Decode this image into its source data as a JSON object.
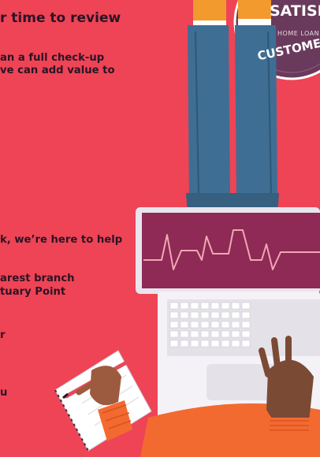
{
  "content": {
    "heading": "r time to review",
    "para1_line1": "an a full check-up",
    "para1_line2": "ve can add value to",
    "help_line": "k, we’re here to help",
    "branch_line1": "arest branch",
    "branch_line2": "tuary Point",
    "fragment_r": "r",
    "fragment_u": "u"
  },
  "badge": {
    "title": "SATISFI",
    "subtitle": "HOME LOAN",
    "arc_text": "CUSTOME"
  },
  "illustration": {
    "icons": [
      "person-on-laptop",
      "laptop",
      "heartbeat-line",
      "notebook",
      "pencil",
      "hand",
      "sneakers"
    ]
  },
  "colors": {
    "background": "#EE4455",
    "text": "#2A1426",
    "badge": "#6A3A5C",
    "jeans": "#3E6E93",
    "sneaker": "#F29A2E",
    "sweater": "#F36A31",
    "laptop_screen": "#8E2A55"
  }
}
